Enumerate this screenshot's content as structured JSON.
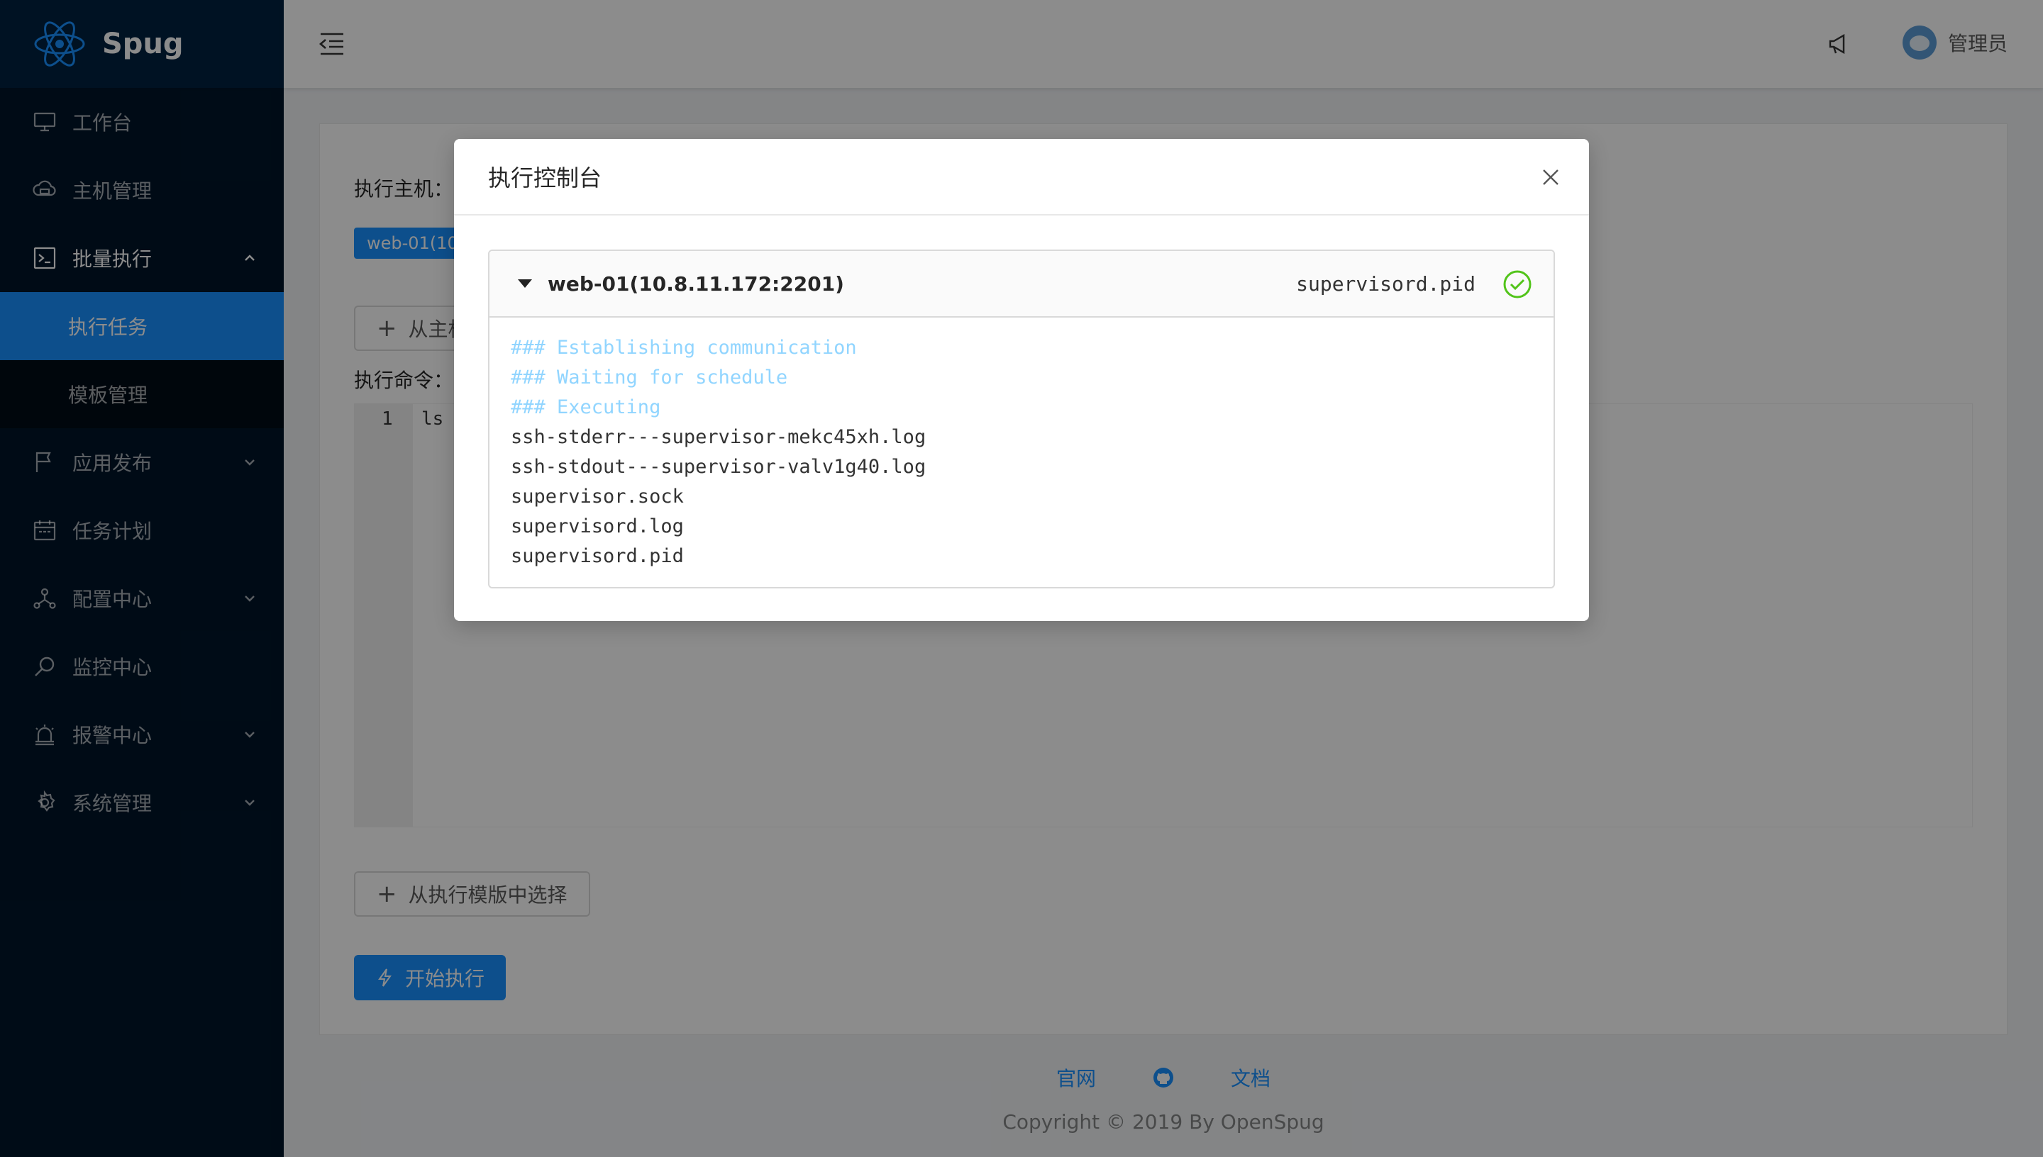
{
  "app": {
    "name": "Spug"
  },
  "sidebar": {
    "items": [
      {
        "label": "工作台",
        "icon": "desktop-icon"
      },
      {
        "label": "主机管理",
        "icon": "cloud-server-icon"
      },
      {
        "label": "批量执行",
        "icon": "code-icon",
        "expanded": true,
        "children": [
          {
            "label": "执行任务",
            "active": true
          },
          {
            "label": "模板管理"
          }
        ]
      },
      {
        "label": "应用发布",
        "icon": "flag-icon"
      },
      {
        "label": "任务计划",
        "icon": "schedule-icon"
      },
      {
        "label": "配置中心",
        "icon": "deployment-icon"
      },
      {
        "label": "监控中心",
        "icon": "monitor-icon"
      },
      {
        "label": "报警中心",
        "icon": "alert-icon"
      },
      {
        "label": "系统管理",
        "icon": "setting-icon"
      }
    ]
  },
  "header": {
    "username": "管理员"
  },
  "form": {
    "host_label": "执行主机：",
    "host_tag": "web-01(10",
    "add_host_btn": "从主机",
    "command_label": "执行命令：",
    "line_number": "1",
    "command_text": "ls /",
    "template_btn": "从执行模版中选择",
    "start_btn": "开始执行"
  },
  "footer": {
    "link_site": "官网",
    "link_docs": "文档",
    "copyright": "Copyright © 2019 By OpenSpug"
  },
  "modal": {
    "title": "执行控制台",
    "host": "web-01(10.8.11.172:2201)",
    "last_output": "supervisord.pid",
    "status": "success",
    "output": [
      {
        "text": "### Establishing communication",
        "kind": "sys"
      },
      {
        "text": "### Waiting for schedule",
        "kind": "sys"
      },
      {
        "text": "### Executing",
        "kind": "sys"
      },
      {
        "text": "ssh-stderr---supervisor-mekc45xh.log",
        "kind": "out"
      },
      {
        "text": "ssh-stdout---supervisor-valv1g40.log",
        "kind": "out"
      },
      {
        "text": "supervisor.sock",
        "kind": "out"
      },
      {
        "text": "supervisord.log",
        "kind": "out"
      },
      {
        "text": "supervisord.pid",
        "kind": "out"
      }
    ]
  },
  "colors": {
    "primary": "#1890ff",
    "sidebar_bg": "#001529",
    "success": "#52c41a"
  }
}
